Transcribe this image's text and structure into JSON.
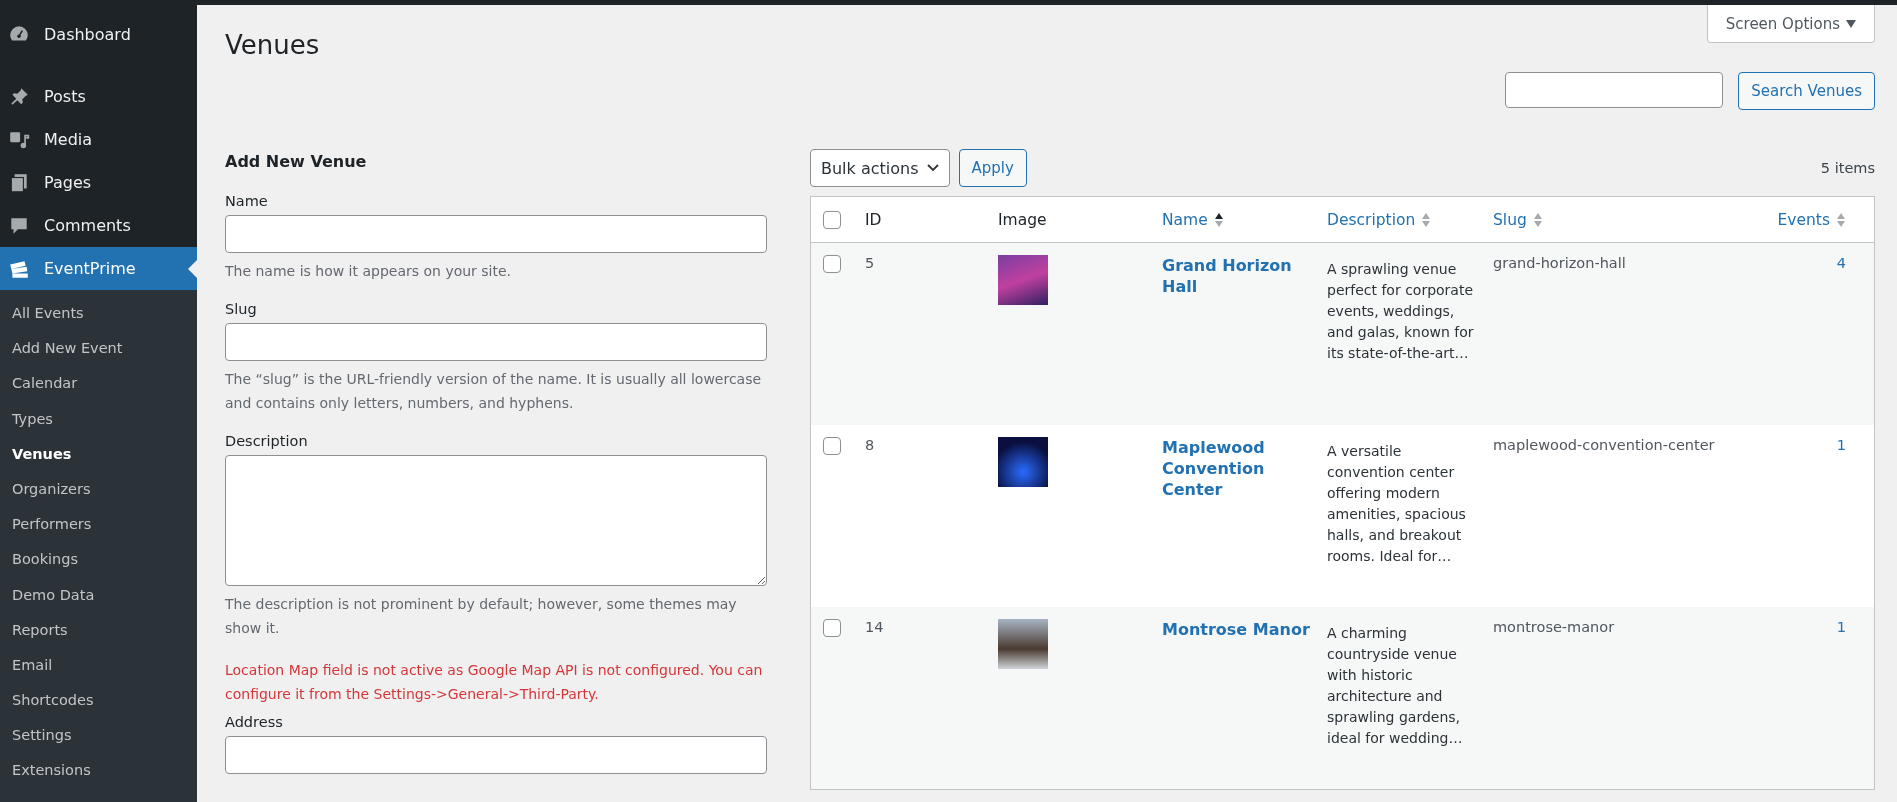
{
  "sidebar": {
    "items": [
      {
        "label": "Dashboard",
        "selected": false
      },
      {
        "label": "Posts",
        "selected": false
      },
      {
        "label": "Media",
        "selected": false
      },
      {
        "label": "Pages",
        "selected": false
      },
      {
        "label": "Comments",
        "selected": false
      },
      {
        "label": "EventPrime",
        "selected": true
      }
    ],
    "submenu": [
      {
        "label": "All Events",
        "selected": false
      },
      {
        "label": "Add New Event",
        "selected": false
      },
      {
        "label": "Calendar",
        "selected": false
      },
      {
        "label": "Types",
        "selected": false
      },
      {
        "label": "Venues",
        "selected": true
      },
      {
        "label": "Organizers",
        "selected": false
      },
      {
        "label": "Performers",
        "selected": false
      },
      {
        "label": "Bookings",
        "selected": false
      },
      {
        "label": "Demo Data",
        "selected": false
      },
      {
        "label": "Reports",
        "selected": false
      },
      {
        "label": "Email",
        "selected": false
      },
      {
        "label": "Shortcodes",
        "selected": false
      },
      {
        "label": "Settings",
        "selected": false
      },
      {
        "label": "Extensions",
        "selected": false
      }
    ]
  },
  "screen_options": "Screen Options",
  "page_title": "Venues",
  "search": {
    "button": "Search Venues"
  },
  "form": {
    "title": "Add New Venue",
    "fields": [
      {
        "kind": "input",
        "label": "Name",
        "hint": "The name is how it appears on your site."
      },
      {
        "kind": "input",
        "label": "Slug",
        "hint": "The “slug” is the URL-friendly version of the name. It is usually all lowercase and contains only letters, numbers, and hyphens."
      },
      {
        "kind": "textarea",
        "label": "Description",
        "hint": "The description is not prominent by default; however, some themes may show it."
      },
      {
        "kind": "error",
        "text": "Location Map field is not active as Google Map API is not configured. You can configure it from the Settings->General->Third-Party."
      },
      {
        "kind": "input",
        "label": "Address"
      }
    ]
  },
  "toolbar": {
    "bulk_actions": "Bulk actions",
    "apply": "Apply",
    "count": "5 items"
  },
  "table": {
    "select_all_checked": false,
    "columns": [
      {
        "label": "ID",
        "kind": "plain"
      },
      {
        "label": "Image",
        "kind": "plain"
      },
      {
        "label": "Name",
        "kind": "sortable",
        "sorted": true
      },
      {
        "label": "Description",
        "kind": "sortable",
        "sorted": false
      },
      {
        "label": "Slug",
        "kind": "sortable",
        "sorted": false
      },
      {
        "label": "Events",
        "kind": "sortable",
        "sorted": false
      }
    ],
    "rows": [
      {
        "checked": false,
        "id": "5",
        "name": "Grand Horizon Hall",
        "description": "A sprawling venue perfect for corporate events, weddings, and galas, known for its state-of-the-art…",
        "slug": "grand-horizon-hall",
        "events": "4"
      },
      {
        "checked": false,
        "id": "8",
        "name": "Maplewood Convention Center",
        "description": "A versatile convention center offering modern amenities, spacious halls, and breakout rooms. Ideal for…",
        "slug": "maplewood-convention-center",
        "events": "1"
      },
      {
        "checked": false,
        "id": "14",
        "name": "Montrose Manor",
        "description": "A charming countryside venue with historic architecture and sprawling gardens, ideal for wedding…",
        "slug": "montrose-manor",
        "events": "1"
      }
    ]
  }
}
